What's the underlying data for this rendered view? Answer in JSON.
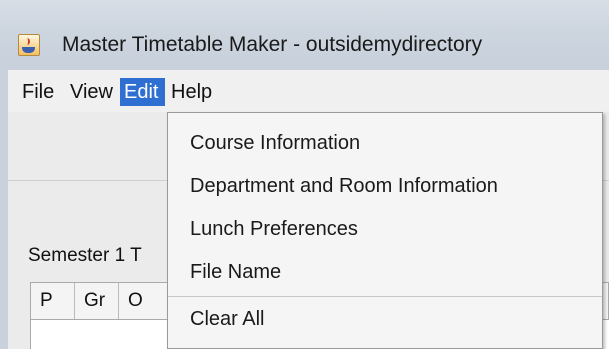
{
  "window": {
    "title": "Master Timetable Maker - outsidemydirectory",
    "icon": "java-cup-icon"
  },
  "menubar": {
    "items": [
      {
        "label": "File"
      },
      {
        "label": "View"
      },
      {
        "label": "Edit",
        "active": true
      },
      {
        "label": "Help"
      }
    ]
  },
  "main": {
    "semester_label": "Semester 1 T",
    "table_columns": [
      "P",
      "Gr",
      "O"
    ]
  },
  "edit_menu": {
    "items": [
      {
        "label": "Course Information"
      },
      {
        "label": "Department and Room Information"
      },
      {
        "label": "Lunch Preferences"
      },
      {
        "label": "File Name"
      },
      {
        "label": "Clear All"
      }
    ]
  },
  "colors": {
    "menu_highlight": "#2e6fd1",
    "titlebar": "#cdd5df"
  }
}
